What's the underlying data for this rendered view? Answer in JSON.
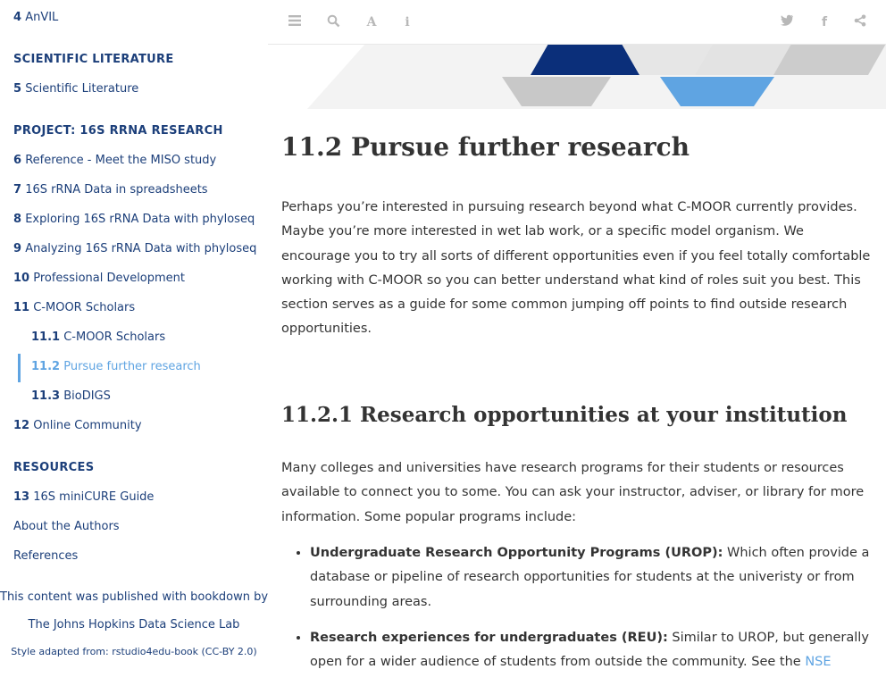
{
  "sidebar": {
    "items": [
      {
        "num": "4",
        "label": "AnVIL"
      },
      {
        "header": "SCIENTIFIC LITERATURE"
      },
      {
        "num": "5",
        "label": "Scientific Literature"
      },
      {
        "header": "PROJECT: 16S RRNA RESEARCH"
      },
      {
        "num": "6",
        "label": "Reference - Meet the MISO study"
      },
      {
        "num": "7",
        "label": "16S rRNA Data in spreadsheets"
      },
      {
        "num": "8",
        "label": "Exploring 16S rRNA Data with phyloseq"
      },
      {
        "num": "9",
        "label": "Analyzing 16S rRNA Data with phyloseq"
      },
      {
        "num": "10",
        "label": "Professional Development"
      },
      {
        "num": "11",
        "label": "C-MOOR Scholars"
      },
      {
        "num": "11.1",
        "label": "C-MOOR Scholars"
      },
      {
        "num": "11.2",
        "label": "Pursue further research"
      },
      {
        "num": "11.3",
        "label": "BioDIGS"
      },
      {
        "num": "12",
        "label": "Online Community"
      },
      {
        "header": "RESOURCES"
      },
      {
        "num": "13",
        "label": "16S miniCURE Guide"
      },
      {
        "label": "About the Authors"
      },
      {
        "label": "References"
      }
    ],
    "footer": {
      "published": "This content was published with bookdown by:",
      "lab": "The Johns Hopkins Data Science Lab",
      "style": "Style adapted from: rstudio4edu-book (CC-BY 2.0)"
    }
  },
  "toolbar": {
    "icons": [
      "menu-icon",
      "search-icon",
      "font-icon",
      "info-icon",
      "twitter-icon",
      "facebook-icon",
      "share-icon"
    ]
  },
  "content": {
    "section_title": "11.2   Pursue further research",
    "intro": "Perhaps you’re interested in pursuing research beyond what C-MOOR currently provides. Maybe you’re more interested in wet lab work, or a specific model organism. We encourage you to try all sorts of different opportunities even if you feel totally comfortable working with C-MOOR so you can better understand what kind of roles suit you best. This section serves as a guide for some common jumping off points to find outside research opportunities.",
    "subsection_title": "11.2.1   Research opportunities at your institution",
    "subsection_intro": "Many colleges and universities have research programs for their students or resources available to connect you to some. You can ask your instructor, adviser, or library for more information. Some popular programs include:",
    "bullets": [
      {
        "bold": "Undergraduate Research Opportunity Programs (UROP):",
        "text": " Which often provide a database or pipeline of research opportunities for students at the univeristy or from surrounding areas."
      },
      {
        "bold": "Research experiences for undergraduates (REU):",
        "text": " Similar to UROP, but generally open for a wider audience of students from outside the community. See the ",
        "link": "NSE"
      }
    ]
  },
  "colors": {
    "navy": "#1c3f7a",
    "accent": "#5fa4e2",
    "banner_dark": "#0b2f7a",
    "banner_light": "#5fa4e2",
    "banner_grey": "#c8c8c8"
  }
}
